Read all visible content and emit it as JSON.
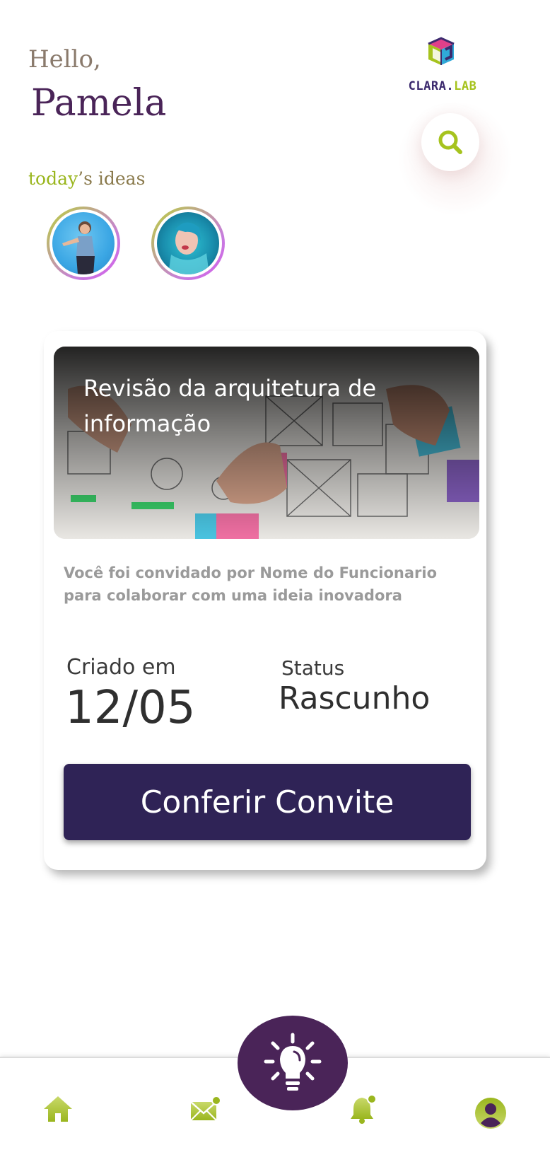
{
  "header": {
    "greeting": "Hello,",
    "user_name": "Pamela",
    "logo_text_main": "CLARA.",
    "logo_text_accent": "LAB",
    "search_icon": "search-icon"
  },
  "ideas": {
    "label_highlight": "today",
    "label_rest": "’s ideas",
    "avatars": [
      {
        "name": "story-avatar-1"
      },
      {
        "name": "story-avatar-2"
      }
    ]
  },
  "invite_card": {
    "title": "Revisão da arquitetura de informação",
    "description": "Você foi convidado por Nome do Funcionario para colaborar com uma ideia inovadora",
    "created_label": "Criado em",
    "created_value": "12/05",
    "status_label": "Status",
    "status_value": "Rascunho",
    "cta_label": "Conferir Convite"
  },
  "nav": {
    "items": [
      {
        "icon": "home-icon"
      },
      {
        "icon": "mail-icon"
      },
      {
        "icon": "lightbulb-icon"
      },
      {
        "icon": "bell-icon"
      },
      {
        "icon": "profile-icon"
      }
    ]
  },
  "colors": {
    "brand_purple": "#4a2458",
    "cta_navy": "#2f2356",
    "accent_green": "#a6c31e"
  }
}
